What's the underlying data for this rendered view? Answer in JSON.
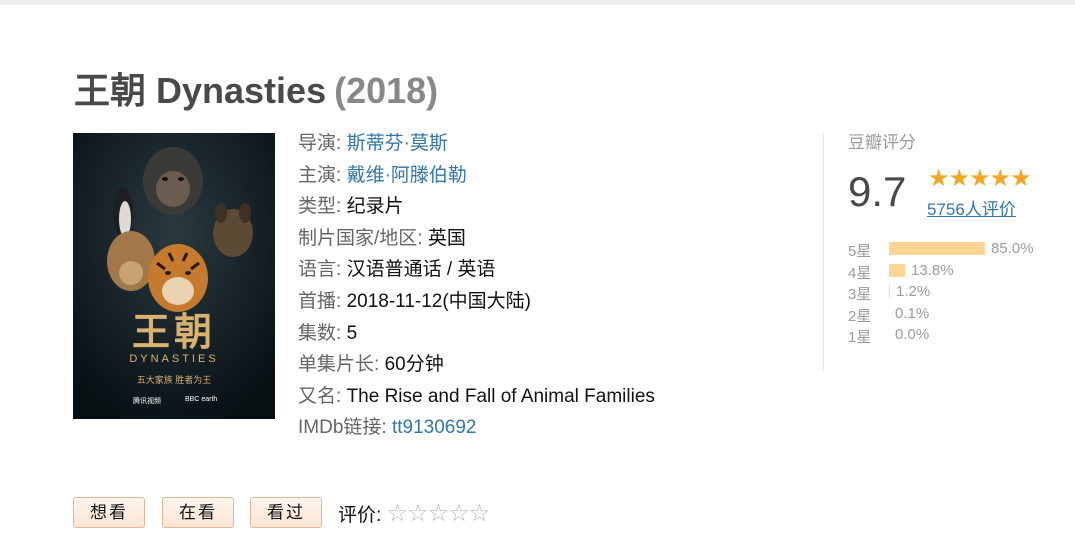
{
  "title": {
    "name": "王朝 Dynasties",
    "year": "(2018)"
  },
  "poster": {
    "title_cn": "王朝",
    "title_en": "DYNASTIES",
    "tagline": "五大家族 胜者为王",
    "logo_left": "腾讯视频",
    "logo_right": "BBC earth"
  },
  "info": {
    "director": {
      "label": "导演:",
      "value": "斯蒂芬·莫斯"
    },
    "cast": {
      "label": "主演:",
      "value": "戴维·阿滕伯勒"
    },
    "genre": {
      "label": "类型:",
      "value": "纪录片"
    },
    "country": {
      "label": "制片国家/地区:",
      "value": "英国"
    },
    "language": {
      "label": "语言:",
      "value": "汉语普通话 / 英语"
    },
    "premiere": {
      "label": "首播:",
      "value": "2018-11-12(中国大陆)"
    },
    "episodes": {
      "label": "集数:",
      "value": "5"
    },
    "runtime": {
      "label": "单集片长:",
      "value": "60分钟"
    },
    "aka": {
      "label": "又名:",
      "value": "The Rise and Fall of Animal Families"
    },
    "imdb": {
      "label": "IMDb链接:",
      "value": "tt9130692"
    }
  },
  "rating": {
    "label": "豆瓣评分",
    "score": "9.7",
    "stars": "★★★★★",
    "count": "5756人评价",
    "distribution": [
      {
        "label": "5星",
        "percent": "85.0%",
        "fraction": 0.85
      },
      {
        "label": "4星",
        "percent": "13.8%",
        "fraction": 0.138
      },
      {
        "label": "3星",
        "percent": "1.2%",
        "fraction": 0.012
      },
      {
        "label": "2星",
        "percent": "0.1%",
        "fraction": 0.001
      },
      {
        "label": "1星",
        "percent": "0.0%",
        "fraction": 0.0
      }
    ],
    "bar_color": "#ffd596",
    "star_color": "#f5a623"
  },
  "actions": {
    "want": "想看",
    "watching": "在看",
    "watched": "看过",
    "rate_label": "评价:",
    "empty_star": "☆"
  },
  "colors": {
    "link": "#3377aa",
    "title": "#494949",
    "year": "#888888"
  }
}
